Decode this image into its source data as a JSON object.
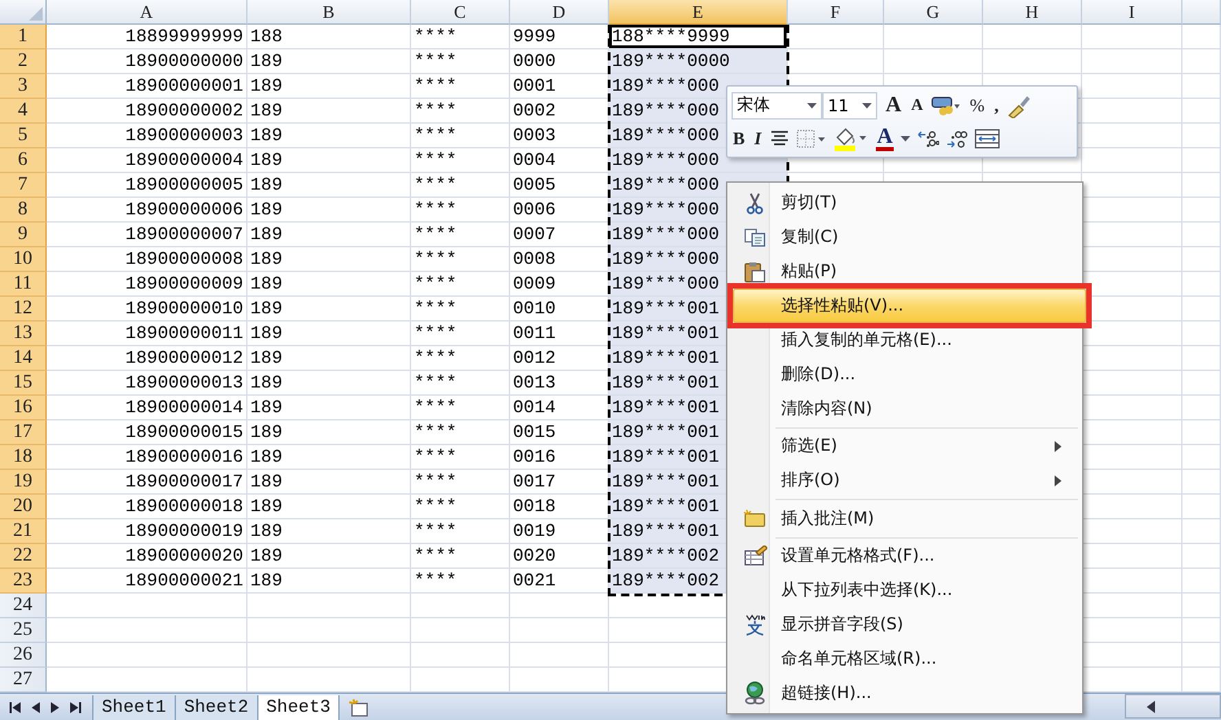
{
  "columns": [
    {
      "label": "A",
      "selected": false
    },
    {
      "label": "B",
      "selected": false
    },
    {
      "label": "C",
      "selected": false
    },
    {
      "label": "D",
      "selected": false
    },
    {
      "label": "E",
      "selected": true
    },
    {
      "label": "F",
      "selected": false
    },
    {
      "label": "G",
      "selected": false
    },
    {
      "label": "H",
      "selected": false
    },
    {
      "label": "I",
      "selected": false
    }
  ],
  "rows": [
    {
      "header": "1",
      "selected": true,
      "active": true,
      "cells": [
        "18899999999",
        "188",
        "****",
        "9999",
        "188****9999"
      ]
    },
    {
      "header": "2",
      "selected": true,
      "active": false,
      "cells": [
        "18900000000",
        "189",
        "****",
        "0000",
        "189****0000"
      ]
    },
    {
      "header": "3",
      "selected": true,
      "active": false,
      "cells": [
        "18900000001",
        "189",
        "****",
        "0001",
        "189****000"
      ]
    },
    {
      "header": "4",
      "selected": true,
      "active": false,
      "cells": [
        "18900000002",
        "189",
        "****",
        "0002",
        "189****000"
      ]
    },
    {
      "header": "5",
      "selected": true,
      "active": false,
      "cells": [
        "18900000003",
        "189",
        "****",
        "0003",
        "189****000"
      ]
    },
    {
      "header": "6",
      "selected": true,
      "active": false,
      "cells": [
        "18900000004",
        "189",
        "****",
        "0004",
        "189****000"
      ]
    },
    {
      "header": "7",
      "selected": true,
      "active": false,
      "cells": [
        "18900000005",
        "189",
        "****",
        "0005",
        "189****000"
      ]
    },
    {
      "header": "8",
      "selected": true,
      "active": false,
      "cells": [
        "18900000006",
        "189",
        "****",
        "0006",
        "189****000"
      ]
    },
    {
      "header": "9",
      "selected": true,
      "active": false,
      "cells": [
        "18900000007",
        "189",
        "****",
        "0007",
        "189****000"
      ]
    },
    {
      "header": "10",
      "selected": true,
      "active": false,
      "cells": [
        "18900000008",
        "189",
        "****",
        "0008",
        "189****000"
      ]
    },
    {
      "header": "11",
      "selected": true,
      "active": false,
      "cells": [
        "18900000009",
        "189",
        "****",
        "0009",
        "189****000"
      ]
    },
    {
      "header": "12",
      "selected": true,
      "active": false,
      "cells": [
        "18900000010",
        "189",
        "****",
        "0010",
        "189****001"
      ]
    },
    {
      "header": "13",
      "selected": true,
      "active": false,
      "cells": [
        "18900000011",
        "189",
        "****",
        "0011",
        "189****001"
      ]
    },
    {
      "header": "14",
      "selected": true,
      "active": false,
      "cells": [
        "18900000012",
        "189",
        "****",
        "0012",
        "189****001"
      ]
    },
    {
      "header": "15",
      "selected": true,
      "active": false,
      "cells": [
        "18900000013",
        "189",
        "****",
        "0013",
        "189****001"
      ]
    },
    {
      "header": "16",
      "selected": true,
      "active": false,
      "cells": [
        "18900000014",
        "189",
        "****",
        "0014",
        "189****001"
      ]
    },
    {
      "header": "17",
      "selected": true,
      "active": false,
      "cells": [
        "18900000015",
        "189",
        "****",
        "0015",
        "189****001"
      ]
    },
    {
      "header": "18",
      "selected": true,
      "active": false,
      "cells": [
        "18900000016",
        "189",
        "****",
        "0016",
        "189****001"
      ]
    },
    {
      "header": "19",
      "selected": true,
      "active": false,
      "cells": [
        "18900000017",
        "189",
        "****",
        "0017",
        "189****001"
      ]
    },
    {
      "header": "20",
      "selected": true,
      "active": false,
      "cells": [
        "18900000018",
        "189",
        "****",
        "0018",
        "189****001"
      ]
    },
    {
      "header": "21",
      "selected": true,
      "active": false,
      "cells": [
        "18900000019",
        "189",
        "****",
        "0019",
        "189****001"
      ]
    },
    {
      "header": "22",
      "selected": true,
      "active": false,
      "cells": [
        "18900000020",
        "189",
        "****",
        "0020",
        "189****002"
      ]
    },
    {
      "header": "23",
      "selected": true,
      "active": false,
      "cells": [
        "18900000021",
        "189",
        "****",
        "0021",
        "189****002"
      ]
    },
    {
      "header": "24",
      "selected": false,
      "active": false
    },
    {
      "header": "25",
      "selected": false,
      "active": false
    },
    {
      "header": "26",
      "selected": false,
      "active": false
    },
    {
      "header": "27",
      "selected": false,
      "active": false
    }
  ],
  "mini_toolbar": {
    "font": "宋体",
    "size": "11",
    "grow_font": "A",
    "shrink_font": "A",
    "percent": "%",
    "comma": ",",
    "bold": "B",
    "italic": "I",
    "font_color": "A"
  },
  "context_menu": [
    {
      "kind": "cut",
      "label": "剪切(T)",
      "selected": false,
      "submenu": false
    },
    {
      "kind": "copy",
      "label": "复制(C)",
      "selected": false,
      "submenu": false
    },
    {
      "kind": "paste",
      "label": "粘贴(P)",
      "selected": false,
      "submenu": false
    },
    {
      "kind": "plain",
      "label": "选择性粘贴(V)...",
      "selected": true,
      "submenu": false
    },
    {
      "kind": "plain",
      "label": "插入复制的单元格(E)...",
      "selected": false,
      "submenu": false
    },
    {
      "kind": "plain",
      "label": "删除(D)...",
      "selected": false,
      "submenu": false
    },
    {
      "kind": "plain",
      "label": "清除内容(N)",
      "selected": false,
      "submenu": false
    },
    {
      "kind": "separator"
    },
    {
      "kind": "plain",
      "label": "筛选(E)",
      "selected": false,
      "submenu": true
    },
    {
      "kind": "plain",
      "label": "排序(O)",
      "selected": false,
      "submenu": true
    },
    {
      "kind": "separator"
    },
    {
      "kind": "comment",
      "label": "插入批注(M)",
      "selected": false,
      "submenu": false
    },
    {
      "kind": "separator"
    },
    {
      "kind": "format",
      "label": "设置单元格格式(F)...",
      "selected": false,
      "submenu": false
    },
    {
      "kind": "plain",
      "label": "从下拉列表中选择(K)...",
      "selected": false,
      "submenu": false
    },
    {
      "kind": "pinyin",
      "label": "显示拼音字段(S)",
      "selected": false,
      "submenu": false
    },
    {
      "kind": "plain",
      "label": "命名单元格区域(R)...",
      "selected": false,
      "submenu": false
    },
    {
      "kind": "link",
      "label": "超链接(H)...",
      "selected": false,
      "submenu": false
    }
  ],
  "sheet_tabs": [
    {
      "label": "Sheet1",
      "selected": false
    },
    {
      "label": "Sheet2",
      "selected": false
    },
    {
      "label": "Sheet3",
      "selected": true
    }
  ]
}
